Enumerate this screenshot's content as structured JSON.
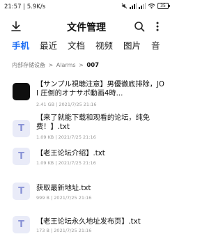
{
  "status_bar": {
    "time_speed": "21:57 | 5.9K/s",
    "battery_level": "35"
  },
  "header": {
    "title": "文件管理"
  },
  "tabs": [
    {
      "label": "手机",
      "active": true
    },
    {
      "label": "最近",
      "active": false
    },
    {
      "label": "文档",
      "active": false
    },
    {
      "label": "视频",
      "active": false
    },
    {
      "label": "图片",
      "active": false
    },
    {
      "label": "音",
      "active": false
    }
  ],
  "breadcrumb": {
    "root": "内部存储设备",
    "sep": ">",
    "middle": "Alarms",
    "current": "007"
  },
  "files": [
    {
      "icon": "video-thumbnail",
      "name": "【サンプル視聴注意】男優徹底排除，JOI 圧倒的オナサポ動画4時...",
      "size": "2.41 GB",
      "sep": "|",
      "date": "2021/7/25 21:16"
    },
    {
      "icon": "text-file-icon",
      "name": "【来了就能下载和观看的论坛，纯免费！】.txt",
      "size": "1.09 KB",
      "sep": "|",
      "date": "2021/7/25 21:16"
    },
    {
      "icon": "text-file-icon",
      "name": "【老王论坛介绍】.txt",
      "size": "1.09 KB",
      "sep": "|",
      "date": "2021/7/25 21:16"
    },
    {
      "icon": "text-file-icon",
      "name": "获取最新地址.txt",
      "size": "999 B",
      "sep": "|",
      "date": "2021/7/25 21:16"
    },
    {
      "icon": "text-file-icon",
      "name": "【老王论坛永久地址发布页】.txt",
      "size": "173 B",
      "sep": "|",
      "date": "2021/7/25 21:16"
    }
  ],
  "txt_icon_letter": "T",
  "colors": {
    "accent": "#1e6ff5",
    "txt_icon_bg": "#e9ebf8",
    "txt_icon_fg": "#8a93d6"
  }
}
